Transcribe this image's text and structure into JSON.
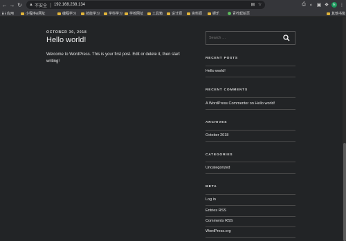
{
  "browser": {
    "insecure_label": "不安全",
    "url": "192.168.238.134",
    "avatar_initial": "E"
  },
  "bookmarks": [
    {
      "label": "应用",
      "type": "apps"
    },
    {
      "label": "小程序&网址",
      "type": "folder"
    },
    {
      "label": "编程学习",
      "type": "folder"
    },
    {
      "label": "技能学习",
      "type": "folder"
    },
    {
      "label": "学科学习",
      "type": "folder"
    },
    {
      "label": "学校网址",
      "type": "folder"
    },
    {
      "label": "工具箱",
      "type": "folder"
    },
    {
      "label": "设计源",
      "type": "folder"
    },
    {
      "label": "资料源",
      "type": "folder"
    },
    {
      "label": "娱乐",
      "type": "folder"
    },
    {
      "label": "青柠起始页",
      "type": "site"
    },
    {
      "label": "其他书签",
      "type": "folder"
    }
  ],
  "post": {
    "date": "OCTOBER 30, 2018",
    "title": "Hello world!",
    "body": "Welcome to WordPress. This is your first post. Edit or delete it, then start writing!"
  },
  "search": {
    "placeholder": "Search …"
  },
  "widgets": {
    "recent_posts": {
      "title": "RECENT POSTS",
      "items": [
        "Hello world!"
      ]
    },
    "recent_comments": {
      "title": "RECENT COMMENTS",
      "items": [
        "A WordPress Commenter on Hello world!"
      ]
    },
    "archives": {
      "title": "ARCHIVES",
      "items": [
        "October 2018"
      ]
    },
    "categories": {
      "title": "CATEGORIES",
      "items": [
        "Uncategorized"
      ]
    },
    "meta": {
      "title": "META",
      "items": [
        "Log in",
        "Entries RSS",
        "Comments RSS",
        "WordPress.org"
      ]
    }
  },
  "colors": {
    "background": "#222426",
    "chrome": "#35363a",
    "folder": "#e0b43a"
  }
}
